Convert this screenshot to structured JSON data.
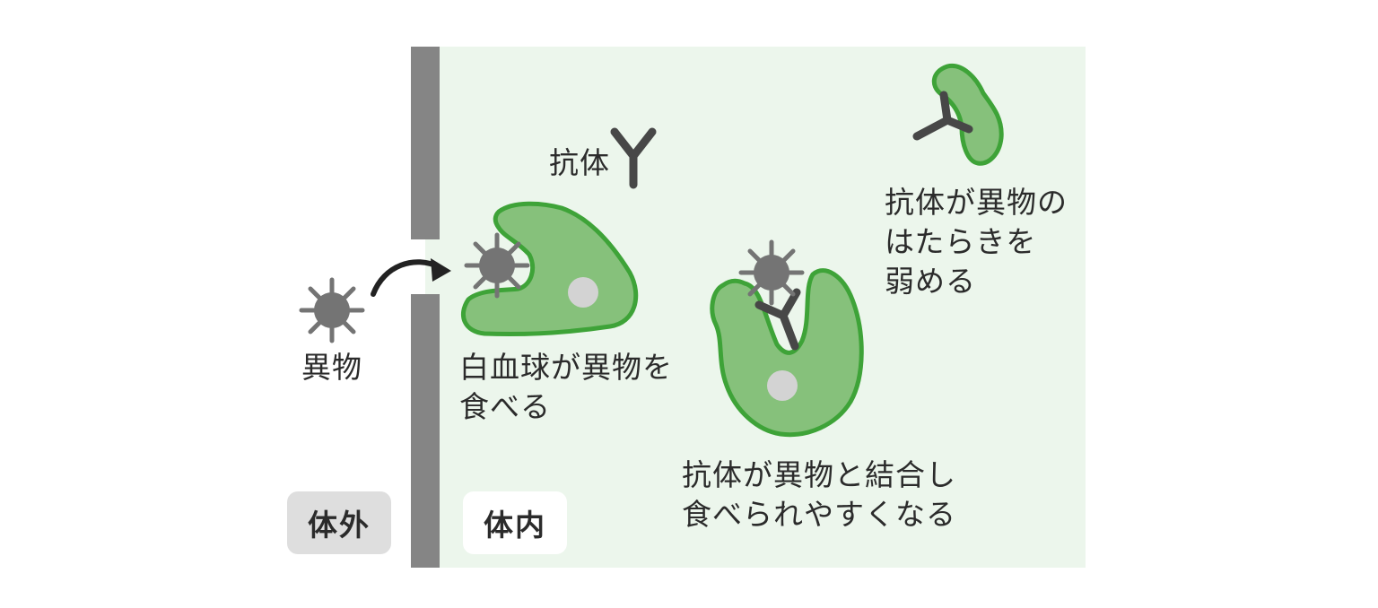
{
  "colors": {
    "inside_bg": "#ecf6ec",
    "wall": "#858585",
    "cell_fill": "#86c17b",
    "cell_stroke": "#3ea338",
    "nucleus": "#d3d3d3",
    "pathogen": "#747474",
    "antibody": "#474747",
    "arrow": "#222222",
    "outside_badge_bg": "#dedede",
    "inside_badge_bg": "#ffffff"
  },
  "regions": {
    "outside_label": "体外",
    "inside_label": "体内"
  },
  "labels": {
    "foreign_object": "異物",
    "antibody": "抗体",
    "phagocytosis": [
      "白血球が異物を",
      "食べる"
    ],
    "opsonization": [
      "抗体が異物と結合し",
      "食べられやすくなる"
    ],
    "neutralization": [
      "抗体が異物の",
      "はたらきを",
      "弱める"
    ]
  },
  "icons": {
    "pathogen": "virus-icon",
    "antibody": "antibody-y-icon",
    "entry_arrow": "curved-arrow-icon"
  }
}
